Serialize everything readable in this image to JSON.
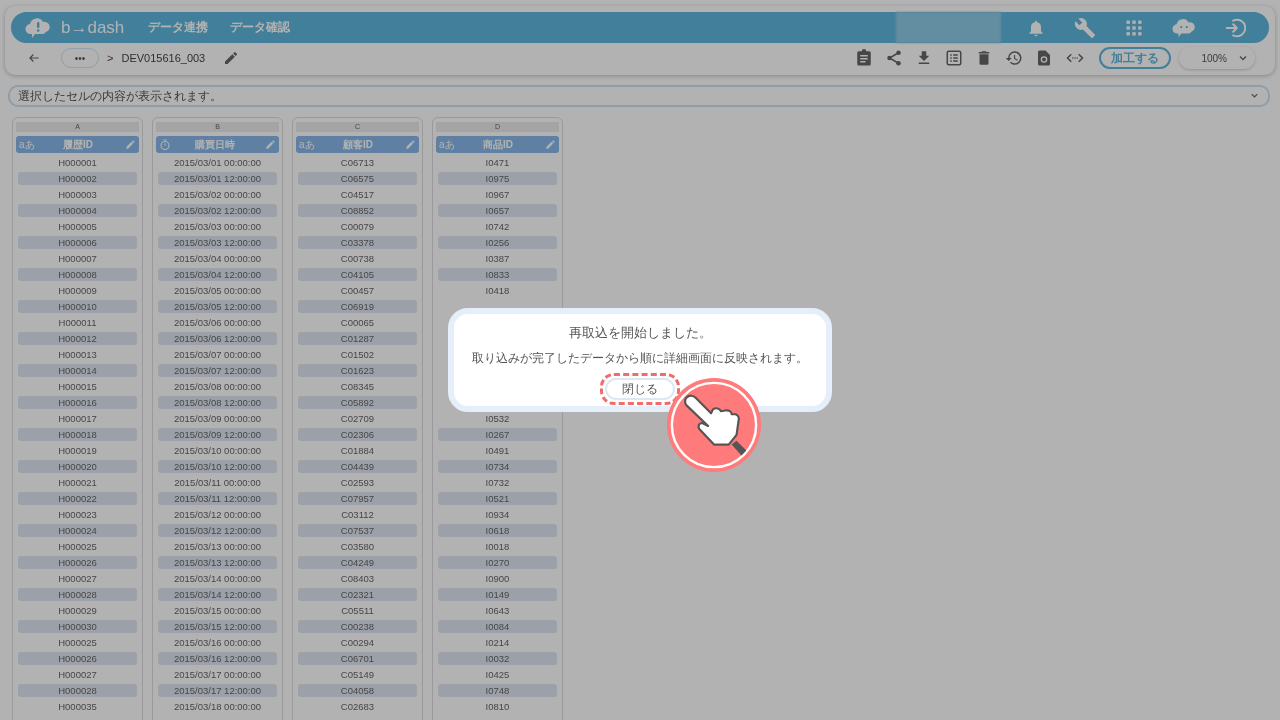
{
  "header": {
    "logo": "b→dash",
    "nav": [
      {
        "label": "データ連携"
      },
      {
        "label": "データ確認"
      }
    ]
  },
  "toolbar": {
    "more": "•••",
    "separator": ">",
    "breadcrumb": "DEV015616_003",
    "process_button": "加工する",
    "zoom": "100%"
  },
  "cell_bar": {
    "placeholder": "選択したセルの内容が表示されます。"
  },
  "columns": [
    {
      "letter": "A",
      "name": "履歴ID",
      "kind": "string",
      "type_icon": "aあ",
      "cells_top": [
        "H000001",
        "H000002",
        "H000003",
        "H000004",
        "H000005",
        "H000006",
        "H000007",
        "H000008",
        "H000009",
        "H000010",
        "H000011",
        "H000012",
        "H000013",
        "H000014",
        "H000015",
        "H000016",
        "H000017",
        "H000018",
        "H000019",
        "H000020",
        "H000021",
        "H000022",
        "H000023",
        "H000024",
        "H000025",
        "H000026",
        "H000027",
        "H000028",
        "H000029",
        "H000030",
        "H000025",
        "H000026",
        "H000027",
        "H000028",
        "H000035"
      ]
    },
    {
      "letter": "B",
      "name": "購買日時",
      "kind": "datetime",
      "cells_top": [
        "2015/03/01 00:00:00",
        "2015/03/01 12:00:00",
        "2015/03/02 00:00:00",
        "2015/03/02 12:00:00",
        "2015/03/03 00:00:00",
        "2015/03/03 12:00:00",
        "2015/03/04 00:00:00",
        "2015/03/04 12:00:00",
        "2015/03/05 00:00:00",
        "2015/03/05 12:00:00",
        "2015/03/06 00:00:00",
        "2015/03/06 12:00:00",
        "2015/03/07 00:00:00",
        "2015/03/07 12:00:00",
        "2015/03/08 00:00:00",
        "2015/03/08 12:00:00",
        "2015/03/09 00:00:00",
        "2015/03/09 12:00:00",
        "2015/03/10 00:00:00",
        "2015/03/10 12:00:00",
        "2015/03/11 00:00:00",
        "2015/03/11 12:00:00",
        "2015/03/12 00:00:00",
        "2015/03/12 12:00:00",
        "2015/03/13 00:00:00",
        "2015/03/13 12:00:00",
        "2015/03/14 00:00:00",
        "2015/03/14 12:00:00",
        "2015/03/15 00:00:00",
        "2015/03/15 12:00:00",
        "2015/03/16 00:00:00",
        "2015/03/16 12:00:00",
        "2015/03/17 00:00:00",
        "2015/03/17 12:00:00",
        "2015/03/18 00:00:00"
      ]
    },
    {
      "letter": "C",
      "name": "顧客ID",
      "kind": "string",
      "type_icon": "aあ",
      "cells_top": [
        "C06713",
        "C06575",
        "C04517",
        "C08852",
        "C00079",
        "C03378",
        "C00738",
        "C04105",
        "C00457",
        "C06919",
        "C00065",
        "C01287",
        "C01502",
        "C01623",
        "C08345",
        "C05892",
        "C02709",
        "C02306",
        "C01884",
        "C04439",
        "C02593",
        "C07957",
        "C03112",
        "C07537",
        "C03580",
        "C04249",
        "C08403",
        "C02321",
        "C05511",
        "C00238",
        "C00294",
        "C06701",
        "C05149",
        "C04058",
        "C02683"
      ]
    },
    {
      "letter": "D",
      "name": "商品ID",
      "kind": "string",
      "type_icon": "aあ",
      "cells_top": [
        "I0471",
        "I0975",
        "I0967",
        "I0657",
        "I0742",
        "I0256",
        "I0387",
        "I0833",
        "I0418"
      ],
      "cells_bottom": [
        "I0532",
        "I0267",
        "I0491",
        "I0734",
        "I0732",
        "I0521",
        "I0934",
        "I0618",
        "I0018",
        "I0270",
        "I0900",
        "I0149",
        "I0643",
        "I0084",
        "I0214",
        "I0032",
        "I0425",
        "I0748",
        "I0810"
      ]
    }
  ],
  "dialog": {
    "title": "再取込を開始しました。",
    "message": "取り込みが完了したデータから順に詳細画面に反映されます。",
    "close_button": "閉じる"
  }
}
